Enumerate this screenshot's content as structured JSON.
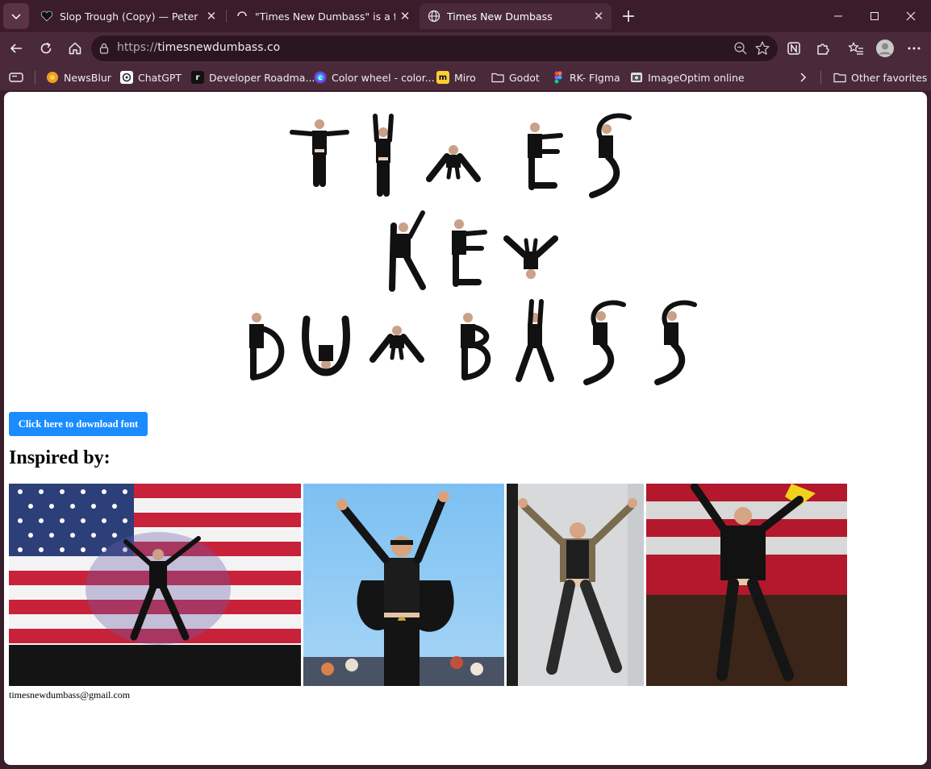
{
  "browser": {
    "tabs": [
      {
        "title": "Slop Trough (Copy) — Peter Henni",
        "favicon": "heart-icon",
        "active": false
      },
      {
        "title": "\"Times New Dumbass\" is a font ins",
        "favicon": "loading-icon",
        "active": false
      },
      {
        "title": "Times New Dumbass",
        "favicon": "globe-icon",
        "active": true
      }
    ],
    "url_protocol": "https://",
    "url_host": "timesnewdumbass.co",
    "bookmarks": [
      {
        "label": "NewsBlur",
        "icon": "newsblur-icon"
      },
      {
        "label": "ChatGPT",
        "icon": "chatgpt-icon"
      },
      {
        "label": "Developer Roadma...",
        "icon": "roadmap-icon"
      },
      {
        "label": "Color wheel - color...",
        "icon": "color-wheel-icon"
      },
      {
        "label": "Miro",
        "icon": "miro-icon"
      },
      {
        "label": "Godot",
        "icon": "folder-icon"
      },
      {
        "label": "RK- FIgma",
        "icon": "figma-icon"
      },
      {
        "label": "ImageOptim online",
        "icon": "imageoptim-icon"
      }
    ],
    "other_favorites": "Other favorites",
    "colors": {
      "frame": "#3a1c2a",
      "toolbar": "#4a2a3a",
      "omnibox": "#2b1520"
    }
  },
  "page": {
    "logo_lines": [
      "TIMES",
      "NEW",
      "DUMBASS"
    ],
    "download_button": "Click here to download font",
    "inspired_heading": "Inspired by:",
    "photos": [
      {
        "name": "flag-jump-photo"
      },
      {
        "name": "sky-jump-photo"
      },
      {
        "name": "stage-x-jump-photo"
      },
      {
        "name": "rally-jump-photo"
      }
    ],
    "email": "timesnewdumbass@gmail.com",
    "accent": "#1a8cff"
  }
}
